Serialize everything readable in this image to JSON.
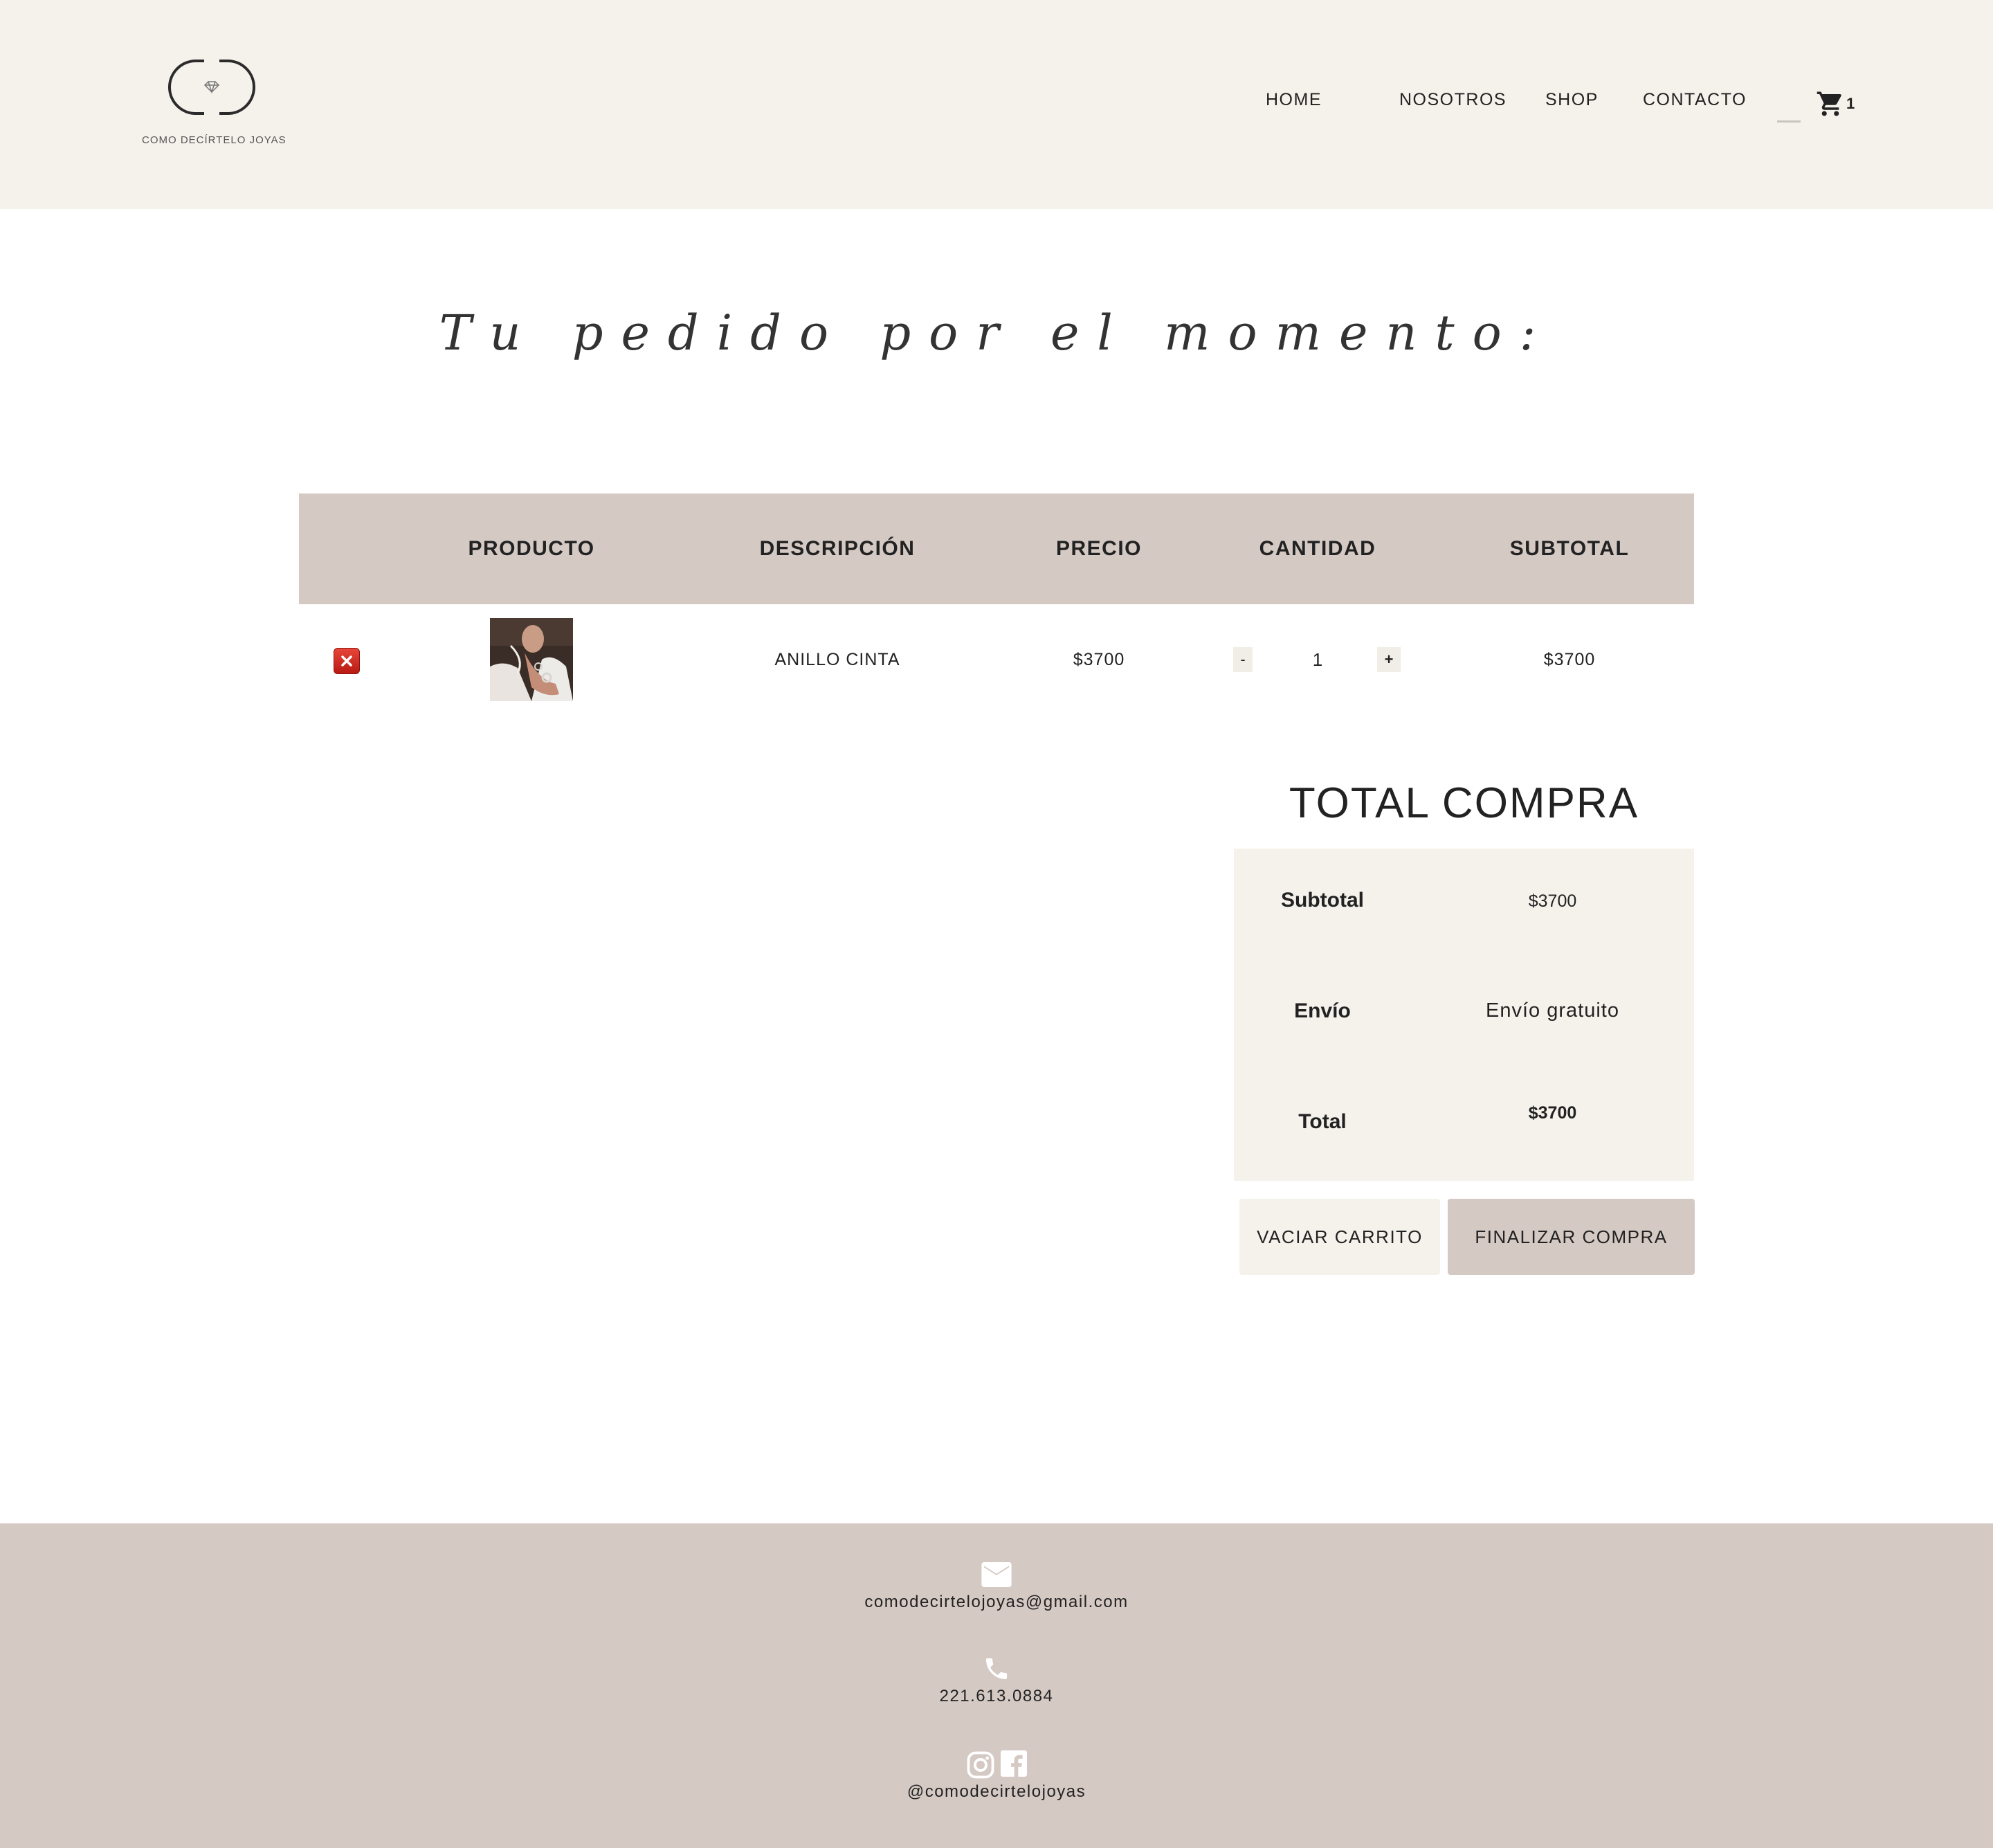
{
  "header": {
    "logo_text": "COMO DECÍRTELO JOYAS",
    "nav": {
      "home": "HOME",
      "about": "NOSOTROS",
      "shop": "SHOP",
      "contact": "CONTACTO"
    },
    "cart_count": "1"
  },
  "main": {
    "title": "Tu pedido por el momento:",
    "table": {
      "headers": [
        "PRODUCTO",
        "DESCRIPCIÓN",
        "PRECIO",
        "CANTIDAD",
        "SUBTOTAL"
      ],
      "rows": [
        {
          "description": "ANILLO CINTA",
          "price": "$3700",
          "qty_minus": "-",
          "quantity": "1",
          "qty_plus": "+",
          "subtotal": "$3700"
        }
      ]
    },
    "totals": {
      "title": "TOTAL COMPRA",
      "subtotal_label": "Subtotal",
      "subtotal_value": "$3700",
      "shipping_label": "Envío",
      "shipping_value": "Envío gratuito",
      "total_label": "Total",
      "total_value": "$3700"
    },
    "buttons": {
      "empty_cart": "VACIAR CARRITO",
      "checkout": "FINALIZAR COMPRA"
    }
  },
  "footer": {
    "email": "comodecirtelojoyas@gmail.com",
    "phone": "221.613.0884",
    "social_handle": "@comodecirtelojoyas"
  },
  "colors": {
    "header_bg": "#f5f2ec",
    "accent": "#d5c9c4",
    "text": "#222222",
    "remove_red": "#d42a1f"
  }
}
